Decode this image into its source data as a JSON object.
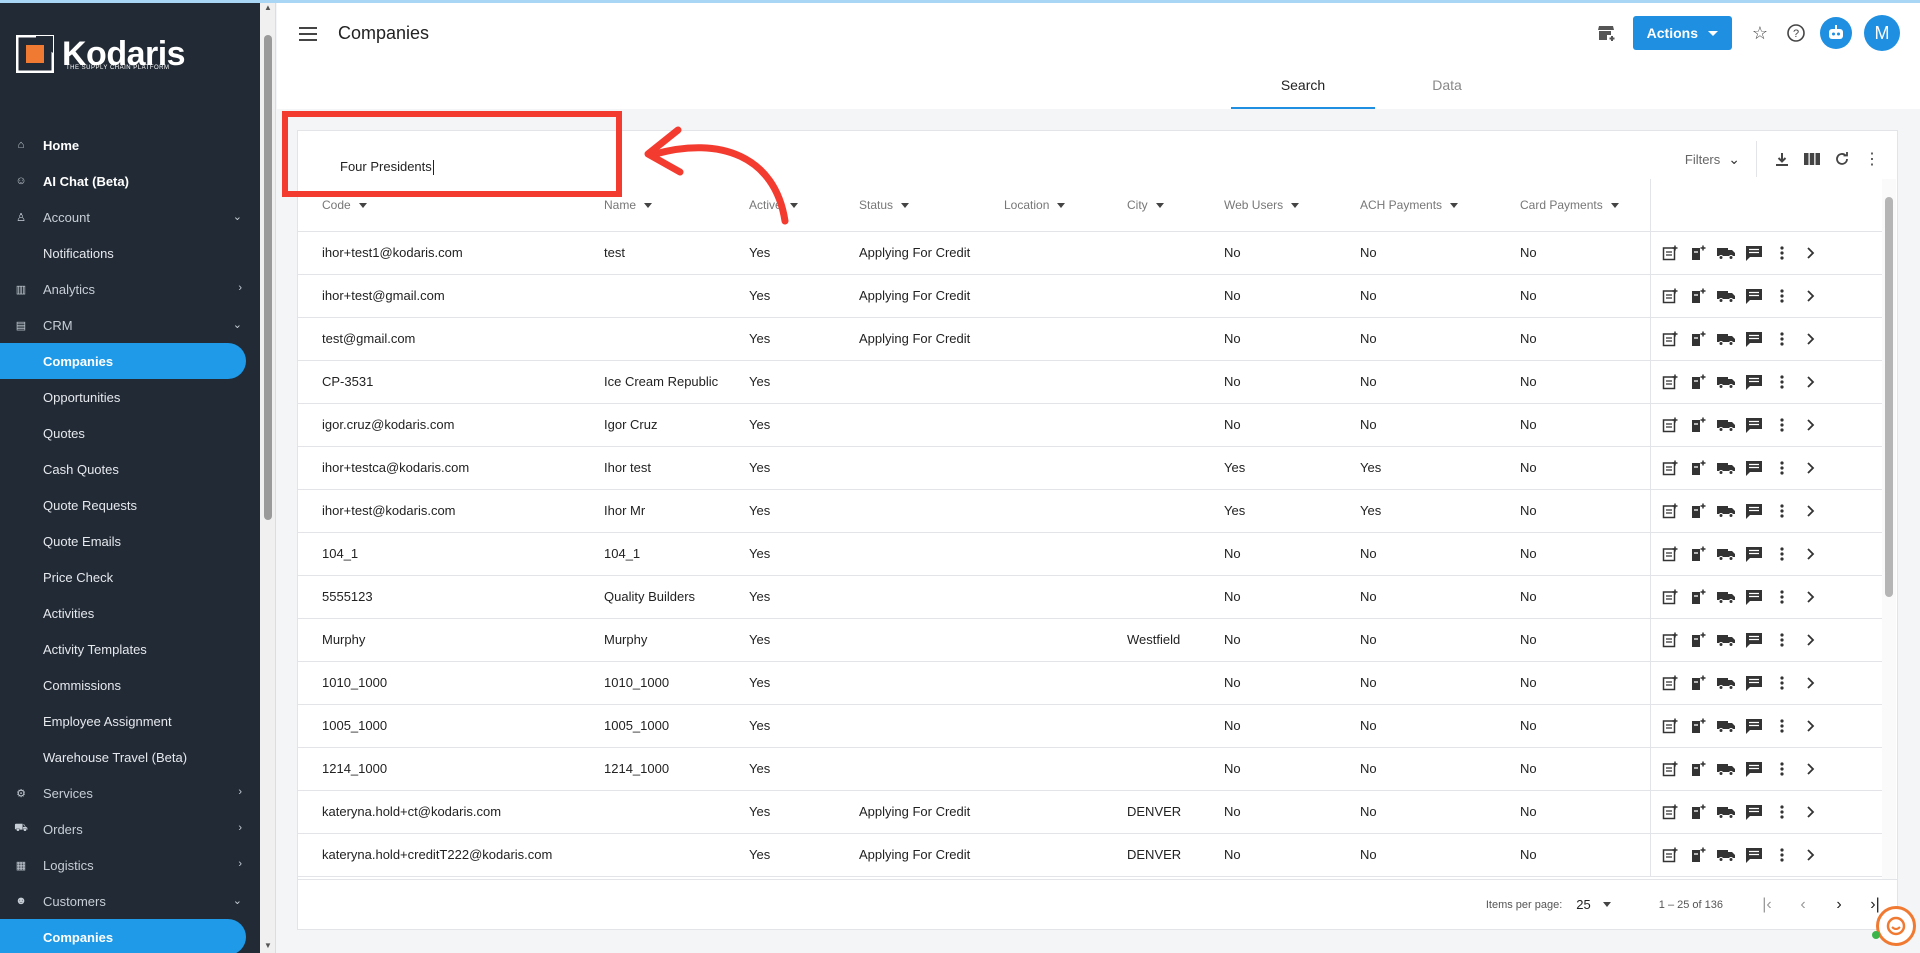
{
  "brand": {
    "name": "Kodaris",
    "tagline": "THE SUPPLY CHAIN PLATFORM",
    "accent": "#1e9ae8",
    "logo_orange": "#f07a32"
  },
  "sidebar": {
    "items": [
      {
        "label": "Home",
        "icon": "home-icon",
        "style": "bold"
      },
      {
        "label": "AI Chat (Beta)",
        "icon": "robot-icon",
        "style": "bold"
      },
      {
        "label": "Account",
        "icon": "person-icon",
        "style": "section",
        "chevron": "down"
      },
      {
        "label": "Notifications",
        "style": "sub"
      },
      {
        "label": "Analytics",
        "icon": "chart-icon",
        "style": "section",
        "chevron": "right"
      },
      {
        "label": "CRM",
        "icon": "crm-icon",
        "style": "section",
        "chevron": "down"
      },
      {
        "label": "Companies",
        "style": "active"
      },
      {
        "label": "Opportunities",
        "style": "sub"
      },
      {
        "label": "Quotes",
        "style": "sub"
      },
      {
        "label": "Cash Quotes",
        "style": "sub"
      },
      {
        "label": "Quote Requests",
        "style": "sub"
      },
      {
        "label": "Quote Emails",
        "style": "sub"
      },
      {
        "label": "Price Check",
        "style": "sub"
      },
      {
        "label": "Activities",
        "style": "sub"
      },
      {
        "label": "Activity Templates",
        "style": "sub"
      },
      {
        "label": "Commissions",
        "style": "sub"
      },
      {
        "label": "Employee Assignment",
        "style": "sub"
      },
      {
        "label": "Warehouse Travel (Beta)",
        "style": "sub"
      },
      {
        "label": "Services",
        "icon": "gears-icon",
        "style": "section",
        "chevron": "right"
      },
      {
        "label": "Orders",
        "icon": "truck-icon",
        "style": "section",
        "chevron": "right"
      },
      {
        "label": "Logistics",
        "icon": "logistics-icon",
        "style": "section",
        "chevron": "right"
      },
      {
        "label": "Customers",
        "icon": "people-icon",
        "style": "section",
        "chevron": "down"
      },
      {
        "label": "Companies",
        "style": "active"
      }
    ]
  },
  "header": {
    "title": "Companies",
    "actions_label": "Actions",
    "avatar_initial": "M"
  },
  "tabs": [
    {
      "label": "Search",
      "active": true
    },
    {
      "label": "Data",
      "active": false
    }
  ],
  "search": {
    "value": "Four Presidents"
  },
  "toolbar": {
    "filters_label": "Filters"
  },
  "table": {
    "columns": [
      "Code",
      "Name",
      "Active",
      "Status",
      "Location",
      "City",
      "Web Users",
      "ACH Payments",
      "Card Payments"
    ],
    "rows": [
      [
        "ihor+test1@kodaris.com",
        "test",
        "Yes",
        "Applying For Credit",
        "",
        "",
        "No",
        "No",
        "No"
      ],
      [
        "ihor+test@gmail.com",
        "",
        "Yes",
        "Applying For Credit",
        "",
        "",
        "No",
        "No",
        "No"
      ],
      [
        "test@gmail.com",
        "",
        "Yes",
        "Applying For Credit",
        "",
        "",
        "No",
        "No",
        "No"
      ],
      [
        "CP-3531",
        "Ice Cream Republic",
        "Yes",
        "",
        "",
        "",
        "No",
        "No",
        "No"
      ],
      [
        "igor.cruz@kodaris.com",
        "Igor Cruz",
        "Yes",
        "",
        "",
        "",
        "No",
        "No",
        "No"
      ],
      [
        "ihor+testca@kodaris.com",
        "Ihor test",
        "Yes",
        "",
        "",
        "",
        "Yes",
        "Yes",
        "No"
      ],
      [
        "ihor+test@kodaris.com",
        "Ihor Mr",
        "Yes",
        "",
        "",
        "",
        "Yes",
        "Yes",
        "No"
      ],
      [
        "104_1",
        "104_1",
        "Yes",
        "",
        "",
        "",
        "No",
        "No",
        "No"
      ],
      [
        "5555123",
        "Quality Builders",
        "Yes",
        "",
        "",
        "",
        "No",
        "No",
        "No"
      ],
      [
        "Murphy",
        "Murphy",
        "Yes",
        "",
        "",
        "Westfield",
        "No",
        "No",
        "No"
      ],
      [
        "1010_1000",
        "1010_1000",
        "Yes",
        "",
        "",
        "",
        "No",
        "No",
        "No"
      ],
      [
        "1005_1000",
        "1005_1000",
        "Yes",
        "",
        "",
        "",
        "No",
        "No",
        "No"
      ],
      [
        "1214_1000",
        "1214_1000",
        "Yes",
        "",
        "",
        "",
        "No",
        "No",
        "No"
      ],
      [
        "kateryna.hold+ct@kodaris.com",
        "",
        "Yes",
        "Applying For Credit",
        "",
        "DENVER",
        "No",
        "No",
        "No"
      ],
      [
        "kateryna.hold+creditT222@kodaris.com",
        "",
        "Yes",
        "Applying For Credit",
        "",
        "DENVER",
        "No",
        "No",
        "No"
      ]
    ],
    "row_action_icons": [
      "add-note-icon",
      "add-document-icon",
      "shipping-truck-icon",
      "comment-icon",
      "more-vert-icon",
      "chevron-right-icon"
    ]
  },
  "pagination": {
    "items_per_page_label": "Items per page:",
    "items_per_page": "25",
    "range": "1 – 25 of 136"
  }
}
